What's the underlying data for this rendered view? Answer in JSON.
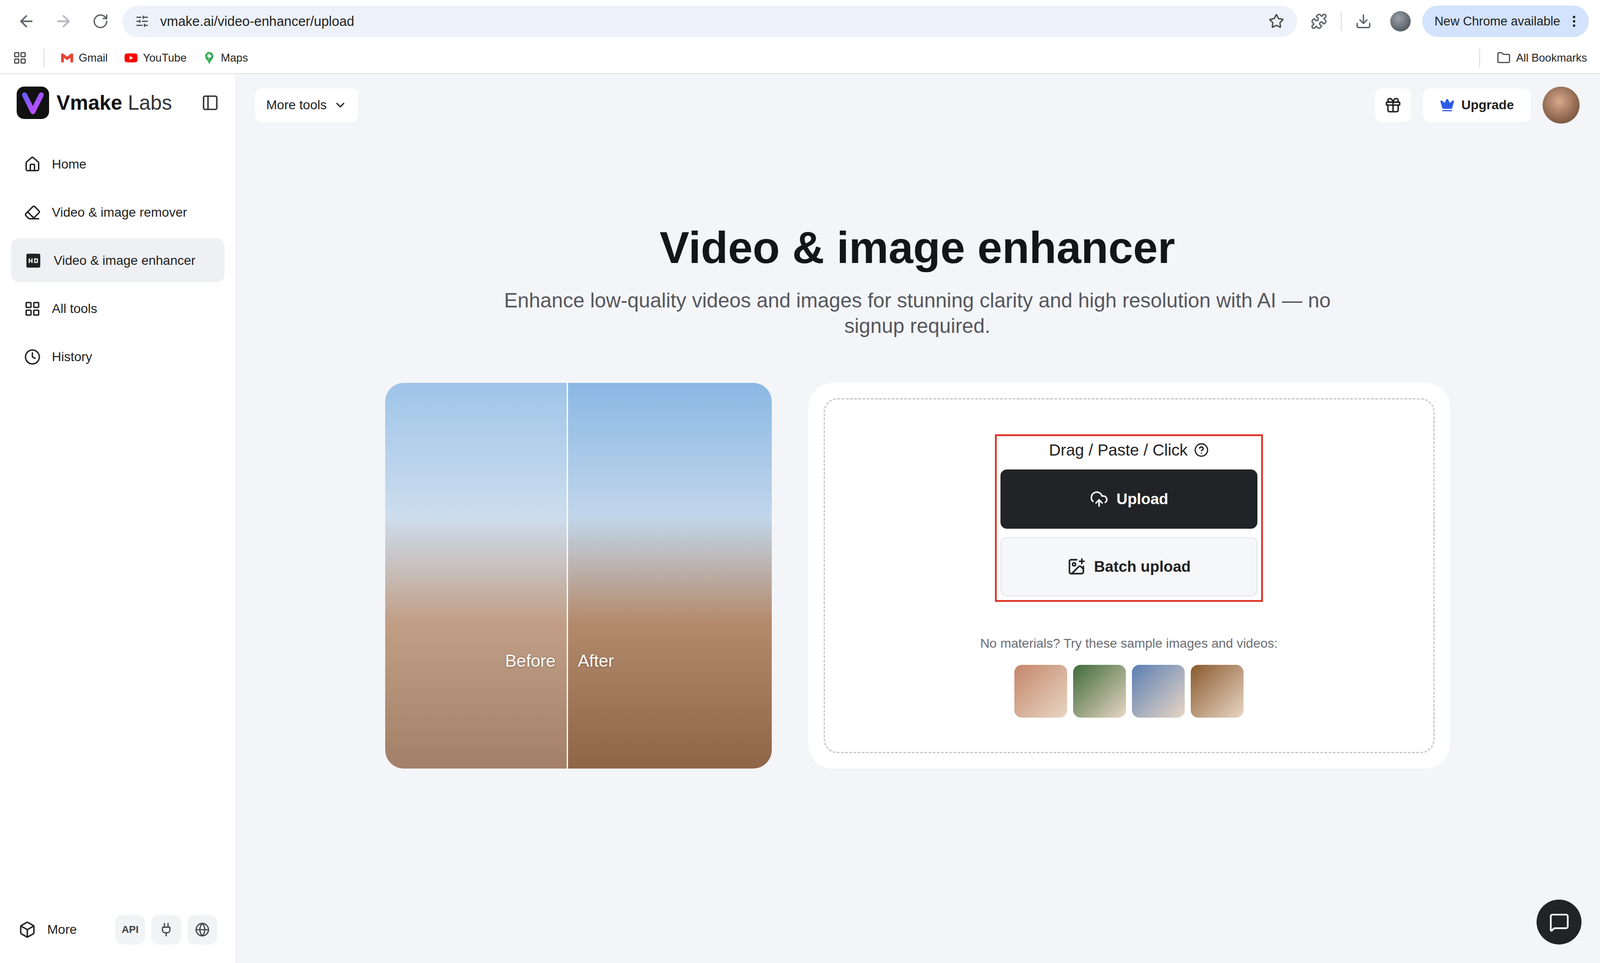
{
  "browser": {
    "address": "vmake.ai/video-enhancer/upload",
    "update_button": "New Chrome available",
    "bookmarks": [
      {
        "label": "Gmail"
      },
      {
        "label": "YouTube"
      },
      {
        "label": "Maps"
      }
    ],
    "all_bookmarks": "All Bookmarks"
  },
  "sidebar": {
    "logo": {
      "name": "Vmake",
      "suffix": "Labs"
    },
    "items": [
      {
        "label": "Home",
        "selected": false
      },
      {
        "label": "Video & image remover",
        "selected": false
      },
      {
        "label": "Video & image enhancer",
        "selected": true
      },
      {
        "label": "All tools",
        "selected": false
      },
      {
        "label": "History",
        "selected": false
      }
    ],
    "footer": {
      "more": "More",
      "api": "API"
    }
  },
  "header": {
    "more_tools": "More tools",
    "upgrade": "Upgrade"
  },
  "hero": {
    "title": "Video & image enhancer",
    "subtitle": "Enhance low-quality videos and images for stunning clarity and high resolution with AI — no signup required."
  },
  "compare": {
    "before": "Before",
    "after": "After",
    "level": 0.47
  },
  "upload": {
    "highlighted": true,
    "hint": "Drag / Paste / Click",
    "upload_button": "Upload",
    "batch_button": "Batch upload",
    "samples_label": "No materials? Try these sample images and videos:",
    "samples": [
      {
        "color": "#c4866a"
      },
      {
        "color": "#3f6b3a"
      },
      {
        "color": "#5b7fb4"
      },
      {
        "color": "#8a5a2e"
      }
    ]
  }
}
